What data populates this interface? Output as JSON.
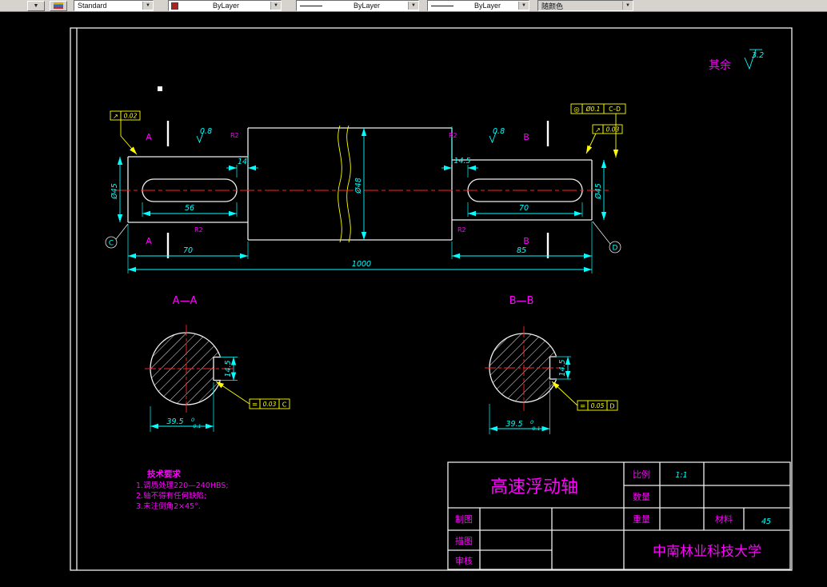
{
  "toolbar": {
    "style": "Standard",
    "color": "ByLayer",
    "linetype": "ByLayer",
    "lineweight": "ByLayer",
    "plot_style": "随颜色"
  },
  "annotation": {
    "surface_label": "其余",
    "surface_value": "3.2"
  },
  "front": {
    "dim_14": "14",
    "dim_56": "56",
    "dim_70_left": "70",
    "dim_14_5": "14.5",
    "dim_70_right": "70",
    "dim_85": "85",
    "dim_1000": "1000",
    "dia_mid": "Ø48",
    "dia_left": "Ø45",
    "dia_right": "Ø45",
    "label_a": "A",
    "label_b": "B",
    "fillet": "R2",
    "rough": "0.8",
    "datum_left": "C",
    "datum_right": "D",
    "gdt_left_sym": "↗",
    "gdt_left_tol": "0.02",
    "gdt_tr_sym": "◎",
    "gdt_tr_tol": "Ø0.1",
    "gdt_tr_datum": "C–D",
    "gdt_r2_sym": "↗",
    "gdt_r2_tol": "0.03"
  },
  "section_a": {
    "title": "A—A",
    "width": "39.5",
    "tol_hi": "0",
    "tol_lo": "-0.1",
    "depth": "14.5",
    "gdt_sym": "=",
    "gdt_tol": "0.03",
    "gdt_datum": "C"
  },
  "section_b": {
    "title": "B—B",
    "width": "39.5",
    "tol_hi": "0",
    "tol_lo": "-0.1",
    "depth": "14.5",
    "gdt_sym": "=",
    "gdt_tol": "0.05",
    "gdt_datum": "D"
  },
  "tech": {
    "title": "技术要求",
    "item1": "1.调质处理220—240HBS;",
    "item2": "2.轴不得有任何缺陷;",
    "item3": "3.未注倒角2×45°."
  },
  "titleblock": {
    "part": "高速浮动轴",
    "scale_label": "比例",
    "scale": "1:1",
    "qty_label": "数量",
    "weight_label": "重量",
    "material_label": "材料",
    "material": "45",
    "draft_label": "制图",
    "trace_label": "描图",
    "check_label": "审核",
    "org": "中南林业科技大学"
  }
}
